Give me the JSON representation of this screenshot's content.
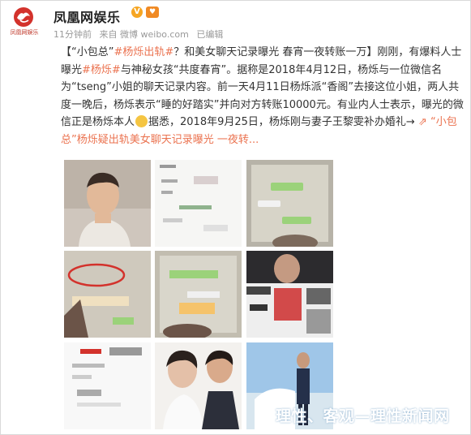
{
  "post": {
    "author": "凤凰网娱乐",
    "logo_caption": "凤凰网娱乐",
    "verified_icon": "v-badge-icon",
    "time": "11分钟前",
    "source": "来自 微博 weibo.com",
    "status": "已编辑",
    "segments": [
      {
        "t": "【“小包总”"
      },
      {
        "t": "#杨烁出轨#",
        "c": "lnk"
      },
      {
        "t": "？和美女聊天记录曝光 春宵一夜转账一万】刚刚，有爆料人士曝光"
      },
      {
        "t": "#杨烁#",
        "c": "lnk"
      },
      {
        "t": "与神秘女孩“共度春宵”。据称是2018年4月12日，杨烁与一位微信名为“tseng”小姐的聊天记录内容。前一天4月11日杨烁派“香阁”去接这位小姐，两人共度一晚后，杨烁表示“睡的好踏实”并向对方转账10000元。有业内人士表示，曝光的微信正是杨烁本人"
      },
      {
        "t": "",
        "emoji": "thinking-emoji"
      },
      {
        "t": "据悉，2018年9月25日，杨烁刚与妻子王黎雯补办婚礼→ "
      },
      {
        "t": "⇗ “小包总”杨烁疑出轨美女聊天记录曝光 一夜转...",
        "c": "lnk"
      }
    ]
  },
  "images": [
    {
      "name": "photo-portrait"
    },
    {
      "name": "chat-screenshot-1"
    },
    {
      "name": "chat-screenshot-2"
    },
    {
      "name": "chat-screenshot-3"
    },
    {
      "name": "chat-screenshot-4"
    },
    {
      "name": "photo-couple-collage"
    },
    {
      "name": "chat-screenshot-5"
    },
    {
      "name": "photo-wedding-1"
    },
    {
      "name": "photo-wedding-2"
    }
  ],
  "watermark": "理性、客观—理性新闻网",
  "colors": {
    "link": "#eb7350",
    "brand": "#c0392b"
  }
}
